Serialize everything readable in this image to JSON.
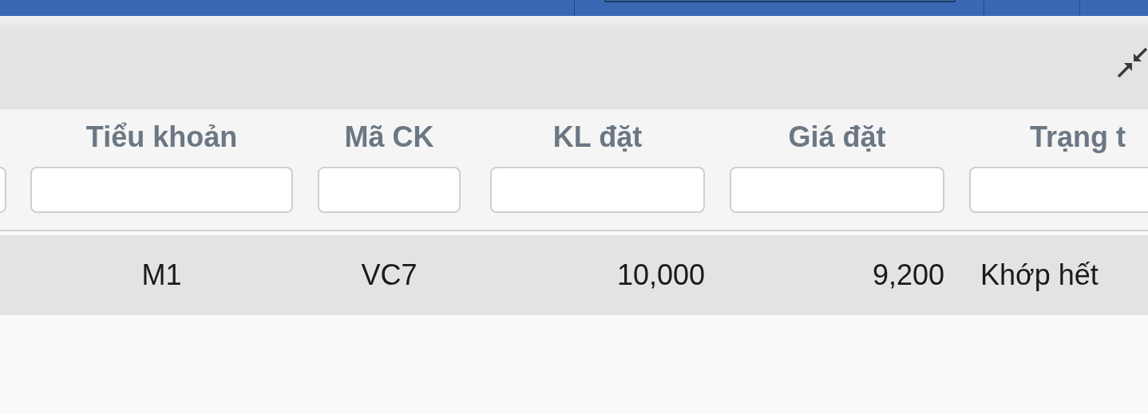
{
  "table": {
    "columns": [
      {
        "label": "Tiểu khoản"
      },
      {
        "label": "Mã CK"
      },
      {
        "label": "KL đặt"
      },
      {
        "label": "Giá đặt"
      },
      {
        "label": "Trạng t"
      }
    ],
    "rows": [
      {
        "selected": true,
        "cells": [
          "M1",
          "VC7",
          "10,000",
          "9,200",
          "Khớp hết"
        ]
      }
    ]
  }
}
